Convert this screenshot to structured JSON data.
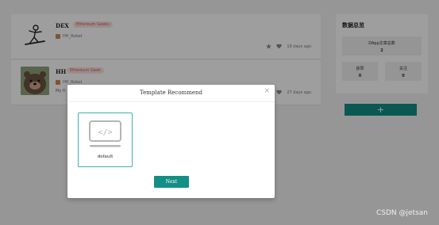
{
  "posts": [
    {
      "name": "DEX",
      "badge": "Ethereum Geeks",
      "author": "HH_Robot",
      "snippet": "",
      "time": "19 days ago",
      "icons": [
        "star-icon",
        "heart-icon"
      ]
    },
    {
      "name": "HH",
      "badge": "Ethereum Geek",
      "author": "HH_Robot",
      "snippet": "My fi",
      "time": "27 days ago",
      "icons": [
        "star-icon",
        "heart-icon"
      ]
    }
  ],
  "stats": {
    "title": "数据总览",
    "total_label": "DApp文章总数",
    "total_value": "2",
    "like_label": "获赞",
    "like_value": "0",
    "follow_label": "关注",
    "follow_value": "0"
  },
  "add_button": {
    "label": "+"
  },
  "modal": {
    "title": "Template Recommend",
    "close_label": "×",
    "template": {
      "name": "default",
      "icon": "code-monitor-icon"
    },
    "next_label": "Next"
  },
  "watermark": "CSDN @jetsan",
  "colors": {
    "accent": "#138f85",
    "badge_text": "#d9534f",
    "badge_bg": "#fbe3e3",
    "overlay": "rgba(0,0,0,0.38)"
  }
}
